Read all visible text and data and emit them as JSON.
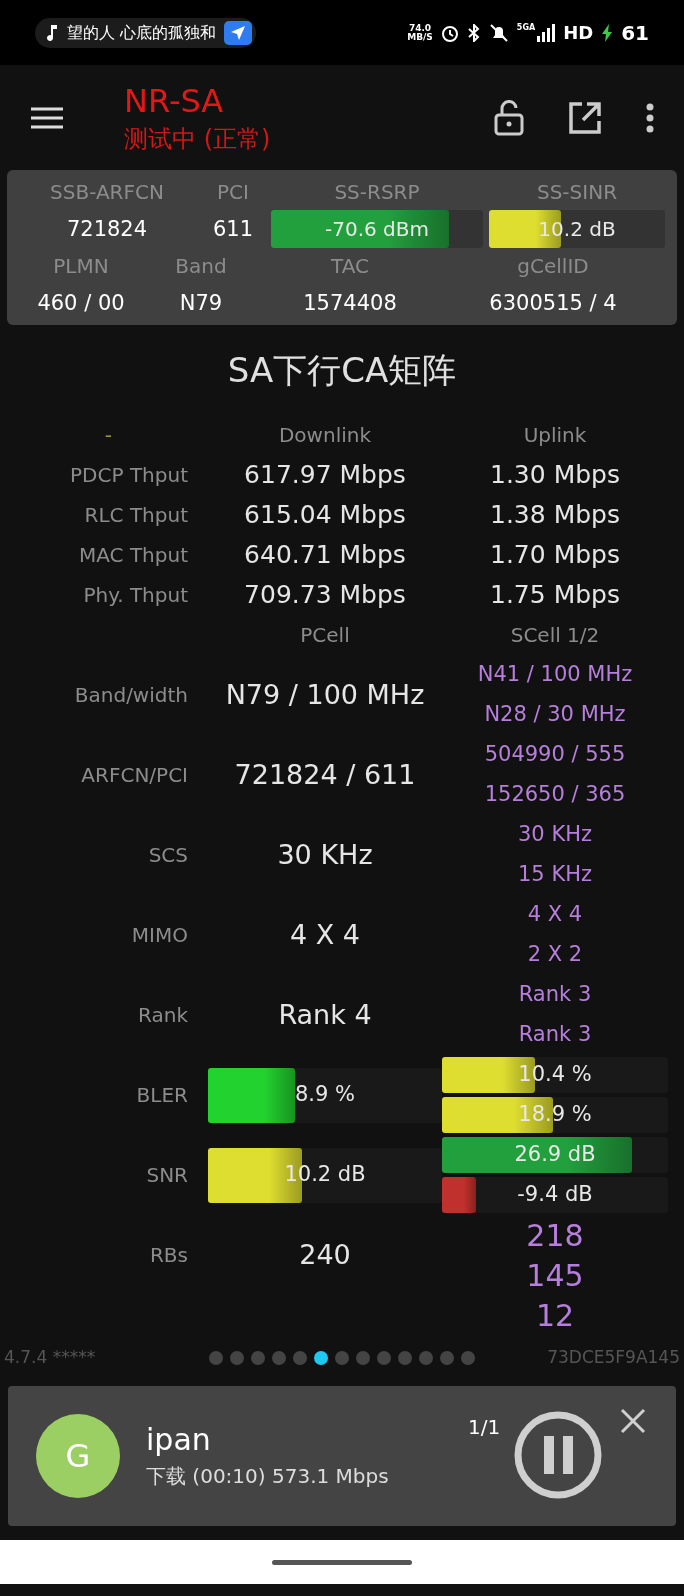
{
  "status_bar": {
    "media_text": "望的人 心底的孤独和",
    "speed": "74.0",
    "speed_unit": "MB/S",
    "network": "5GA",
    "hd": "HD",
    "battery": "61"
  },
  "app_bar": {
    "title": "NR-SA",
    "subtitle": "测试中 (正常)"
  },
  "cell_info": {
    "rows": [
      [
        {
          "label": "SSB-ARFCN",
          "kind": "text",
          "value": "721824"
        },
        {
          "label": "PCI",
          "kind": "text",
          "value": "611"
        },
        {
          "label": "SS-RSRP",
          "kind": "bar",
          "value": "-70.6 dBm",
          "level": 0.84,
          "color": "#23a03e"
        },
        {
          "label": "SS-SINR",
          "kind": "bar",
          "value": "10.2 dB",
          "level": 0.41,
          "color": "#dede30"
        }
      ],
      [
        {
          "label": "PLMN",
          "kind": "text",
          "value": "460 / 00"
        },
        {
          "label": "Band",
          "kind": "text",
          "value": "N79"
        },
        {
          "label": "TAC",
          "kind": "text",
          "value": "1574408"
        },
        {
          "label": "gCellID",
          "kind": "text",
          "value": "6300515 / 4"
        }
      ]
    ]
  },
  "matrix": {
    "title": "SA下行CA矩阵",
    "throughput": {
      "columns": [
        "-",
        "Downlink",
        "Uplink"
      ],
      "rows": [
        {
          "label": "PDCP Thput",
          "downlink": "617.97 Mbps",
          "uplink": "1.30 Mbps"
        },
        {
          "label": "RLC Thput",
          "downlink": "615.04 Mbps",
          "uplink": "1.38 Mbps"
        },
        {
          "label": "MAC Thput",
          "downlink": "640.71 Mbps",
          "uplink": "1.70 Mbps"
        },
        {
          "label": "Phy. Thput",
          "downlink": "709.73 Mbps",
          "uplink": "1.75 Mbps"
        }
      ]
    },
    "cells": {
      "columns": [
        "PCell",
        "SCell 1/2"
      ],
      "rows": [
        {
          "label": "Band/width",
          "pcell": {
            "kind": "text",
            "value": "N79 / 100 MHz"
          },
          "scell": [
            {
              "kind": "text",
              "value": "N41 / 100 MHz"
            },
            {
              "kind": "text",
              "value": "N28 / 30 MHz"
            }
          ]
        },
        {
          "label": "ARFCN/PCI",
          "pcell": {
            "kind": "text",
            "value": "721824 / 611"
          },
          "scell": [
            {
              "kind": "text",
              "value": "504990 / 555"
            },
            {
              "kind": "text",
              "value": "152650 / 365"
            }
          ]
        },
        {
          "label": "SCS",
          "pcell": {
            "kind": "text",
            "value": "30 KHz"
          },
          "scell": [
            {
              "kind": "text",
              "value": "30 KHz"
            },
            {
              "kind": "text",
              "value": "15 KHz"
            }
          ]
        },
        {
          "label": "MIMO",
          "pcell": {
            "kind": "text",
            "value": "4 X 4"
          },
          "scell": [
            {
              "kind": "text",
              "value": "4 X 4"
            },
            {
              "kind": "text",
              "value": "2 X 2"
            }
          ]
        },
        {
          "label": "Rank",
          "pcell": {
            "kind": "text",
            "value": "Rank 4"
          },
          "scell": [
            {
              "kind": "text",
              "value": "Rank 3"
            },
            {
              "kind": "text",
              "value": "Rank 3"
            }
          ]
        },
        {
          "label": "BLER",
          "pcell": {
            "kind": "bar",
            "value": "8.9 %",
            "level": 0.37,
            "color": "#22d22e"
          },
          "scell": [
            {
              "kind": "bar",
              "value": "10.4 %",
              "level": 0.41,
              "color": "#dede30"
            },
            {
              "kind": "bar",
              "value": "18.9 %",
              "level": 0.49,
              "color": "#dede30"
            }
          ]
        },
        {
          "label": "SNR",
          "pcell": {
            "kind": "bar",
            "value": "10.2 dB",
            "level": 0.4,
            "color": "#dede30"
          },
          "scell": [
            {
              "kind": "bar",
              "value": "26.9 dB",
              "level": 0.84,
              "color": "#23a03e"
            },
            {
              "kind": "bar",
              "value": "-9.4 dB",
              "level": 0.15,
              "color": "#c0302c"
            }
          ]
        },
        {
          "label": "RBs",
          "pcell": {
            "kind": "text",
            "value": "240"
          },
          "scell": [
            {
              "kind": "number",
              "value": "218"
            },
            {
              "kind": "number",
              "value": "145"
            }
          ]
        },
        {
          "scell": [
            {
              "kind": "number",
              "value": "12"
            }
          ]
        }
      ]
    }
  },
  "footer": {
    "version": "4.7.4 *****",
    "device_id": "73DCE5F9A145",
    "pages": [
      {
        "selected": false
      },
      {
        "selected": false
      },
      {
        "selected": false
      },
      {
        "selected": false
      },
      {
        "selected": false
      },
      {
        "selected": true
      },
      {
        "selected": false
      },
      {
        "selected": false
      },
      {
        "selected": false
      },
      {
        "selected": false
      },
      {
        "selected": false
      },
      {
        "selected": false
      },
      {
        "selected": false
      }
    ]
  },
  "notification": {
    "avatar_letter": "G",
    "title": "ipan",
    "detail": "下载 (00:10) 573.1 Mbps",
    "count": "1/1"
  }
}
